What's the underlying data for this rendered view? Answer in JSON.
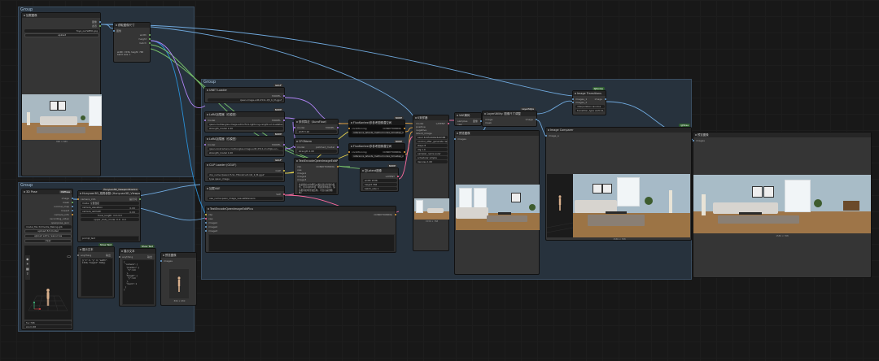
{
  "groups": {
    "top_left": "Group",
    "bottom_left": "Group",
    "main": "Group"
  },
  "load_image_node": {
    "title": "加载图像",
    "outputs": [
      "图像",
      "遮罩"
    ],
    "image_field": "Tuye_oe7e8f01.jpg",
    "upload_button": "upload",
    "caption": "896 × 680"
  },
  "image_size_node": {
    "title": "获取图像尺寸",
    "input": "图像",
    "outputs": [
      "width",
      "height",
      "batch"
    ],
    "info_text": "width: 1536, height: 768\nbatch size: 1"
  },
  "pose_node": {
    "title": "3D Pose",
    "badge": "DWPose",
    "outputs": [
      "image",
      "mask",
      "normal_map",
      "lineart",
      "camera_info",
      "recording_video",
      "openpose_json"
    ],
    "fields": [
      "model_file 3d/modle_Baking.glb",
      "width 896",
      "height 680"
    ],
    "buttons": [
      "upload 3d model",
      "upload extra resources",
      "clear"
    ],
    "bottom_fields": [
      "fov 768",
      "zoom 68"
    ]
  },
  "camera_node": {
    "title": "Hunyuan3D_视角参数 (Hunyuan3D_ViewpointPoint)",
    "badge": "Hunyuan3D_ViewpointControl",
    "input": "camera_info",
    "output": "提示词",
    "fields": [
      "mode: 全量数据",
      "camera_elevation",
      "camera_azimuth",
      "focal_length: mm 0.0"
    ],
    "fields_values": [
      "0.00",
      "0.00"
    ],
    "info": "upper_body_mode: 0.0 · 0.0",
    "sub_title": "prompt_text",
    "text_value": "prompt_text"
  },
  "show_text_left": {
    "title": "展示文本",
    "badge": "Show Text",
    "input": "anything",
    "output": "输出",
    "text": "[{\"x\": 0, \"y\": 0, \"width\": 1536, \"height\": 768}]"
  },
  "show_text_mid": {
    "title": "展示文本",
    "badge": "Show Text",
    "input": "anything",
    "output": "输出",
    "text": "{\n  \"camera\": {\n    \"position\": {\n      \"x\": 0.0\n    },\n    \"target\": {\n      \"y\": 0.0\n    },\n    \"zoom\": 1\n  }\n}"
  },
  "preview_small": {
    "title": "预览图像",
    "input": "images",
    "caption": "896 × 680"
  },
  "unet_loader": {
    "title": "UNET Loader",
    "badge": "GGUF",
    "output": "MODEL",
    "field": "qwen-image-edit-2511-Q5_K_M.gguf"
  },
  "lora1": {
    "title": "LoRA加载器（仅模型）",
    "badge": "NODE",
    "input": "model",
    "output": "MODEL",
    "lora_field": "qwen-multiangles-image-edit-2511-lightning-relight-v2.0.safetensors",
    "strength": "strength_model 1.00"
  },
  "lora2": {
    "title": "LoRA加载器（仅模型）",
    "badge": "NODE",
    "input": "model",
    "output": "MODEL",
    "lora_field": "qwen-lookcamera-multiangles-image-edit-2511-multiple-an...",
    "strength": "strength_model 1.00"
  },
  "clip_loader": {
    "title": "CLIP Loader (GGUF)",
    "badge": "GGUF",
    "output": "CLIP",
    "fields": [
      "clip_name  Qwen2.5-VL-7B-Instruct-Q4_K_M.gguf",
      "type  qwen_image"
    ]
  },
  "vae_loader": {
    "title": "加载VAE",
    "output": "VAE",
    "field": "vae_name  qwen_image_vae.safetensors"
  },
  "text_encode_big": {
    "title": "TextEncodeQwenImageEditPlus",
    "output": "CONDITIONING",
    "inputs": [
      "clip",
      "vae",
      "image1",
      "image2",
      "image3"
    ]
  },
  "model_sampling": {
    "title": "采样算法（AuraFlow）",
    "badge": "NODE",
    "input": "model",
    "output": "MODEL",
    "field": "shift  3.10"
  },
  "cfg_norm": {
    "title": "CFGNorm",
    "input": "model",
    "output": "patched_model",
    "field": "strength  1.00"
  },
  "text_encode_small": {
    "title": "TextEncodeQwenImageEditPlus",
    "inputs": [
      "clip",
      "vae",
      "image1",
      "image2",
      "image3"
    ],
    "output": "CONDITIONING",
    "prompt": "将此图片中的相机从图片转动到新的视角，水平转向40度（相机朝向右前，保持相同的场景和结构，不显示其他物体）"
  },
  "flux_guidance_pos": {
    "title": "FluxKontext多参考图像潜空间",
    "input": "conditioning",
    "output": "CONDITIONING",
    "field": "reference_latents_method  index_timestep_zero",
    "badge": "NODE"
  },
  "flux_guidance_neg": {
    "title": "FluxKontext多参考图像潜空间",
    "input": "conditioning",
    "output": "CONDITIONING",
    "field": "reference_latents_method  index_timestep_zero",
    "badge": "NODE"
  },
  "empty_latent": {
    "title": "空Latent图像",
    "badge": "NODE",
    "output": "LATENT",
    "fields": [
      "width 1536",
      "height 768",
      "batch_size 1"
    ]
  },
  "ksampler": {
    "title": "K采样器",
    "inputs": [
      "model",
      "positive",
      "negative",
      "latent_image"
    ],
    "output": "LATENT",
    "fields": [
      "seed 424524662649388",
      "control_after_generate randomize",
      "steps 8",
      "cfg 1.0",
      "sampler_name euler",
      "scheduler simple",
      "denoise 1.00"
    ],
    "caption": "1536 × 768"
  },
  "vae_decode": {
    "title": "VAE解码",
    "inputs": [
      "samples",
      "vae"
    ],
    "output": "图像"
  },
  "preview_main": {
    "title": "预览图像",
    "input": "images"
  },
  "layer_style": {
    "title": "LayerStyle",
    "sub": "LayerUtility: 图像尺寸调整",
    "badge": "LayerStyle",
    "inputs": [
      "image",
      "mask"
    ],
    "outputs": [
      "image",
      "mask",
      "original_size"
    ]
  },
  "transition": {
    "title": "Image Transitions",
    "badge": "KJNodes",
    "inputs": [
      "images_1",
      "images_2"
    ],
    "output": "image",
    "fields": [
      "interpolation lanczos",
      "transition_type vertical_slide",
      "frames 24"
    ]
  },
  "compare_node": {
    "title": "Image Comparer",
    "badge": "rgthree",
    "inputs": [
      "image_a",
      "image_b"
    ],
    "caption": "1536 × 768"
  },
  "right_preview": {
    "title": "预览图像",
    "input": "images",
    "caption": "1536 × 768"
  },
  "colors": {
    "group_bg": "#27323d",
    "node_bg": "#353535",
    "wire_blue": "#6fa8dc",
    "wire_orange": "#e8a33d",
    "wire_pink": "#ff6b9e",
    "wire_yellow": "#e6d14b",
    "wire_purple": "#b084f5",
    "wire_green": "#79c36a"
  }
}
